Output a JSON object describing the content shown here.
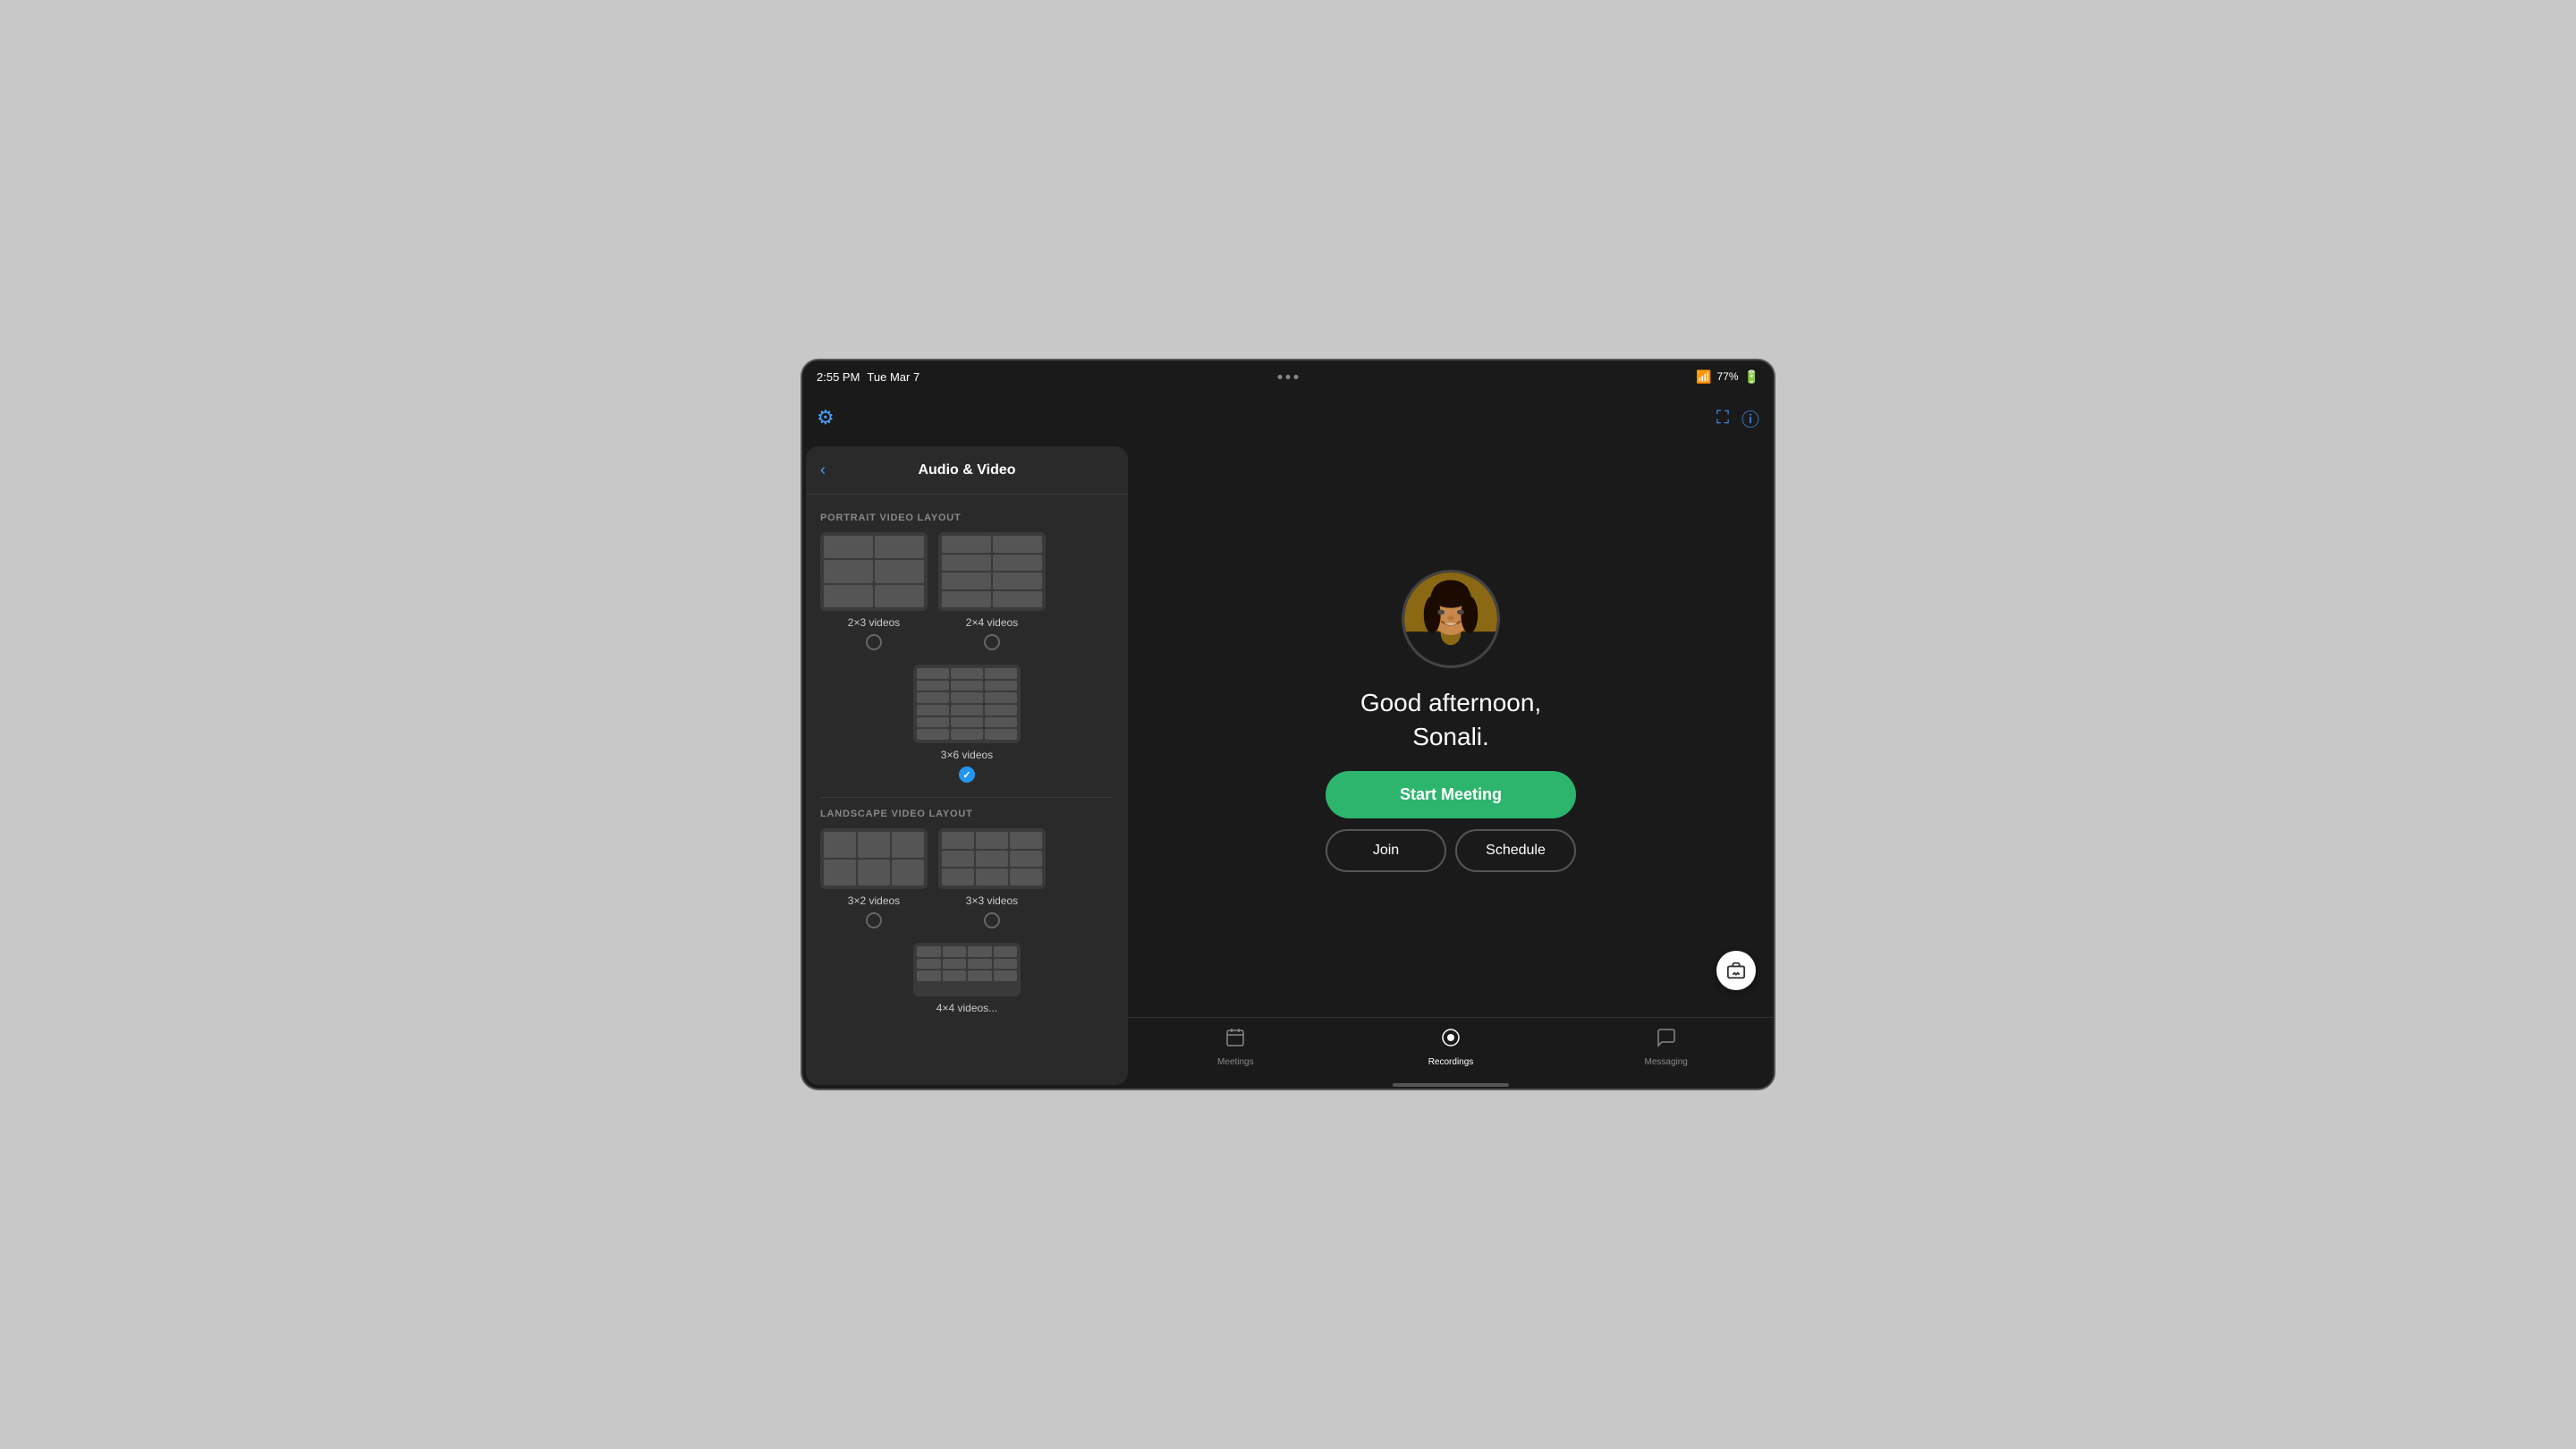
{
  "device": {
    "status_bar": {
      "time": "2:55 PM",
      "date": "Tue Mar 7",
      "wifi_percent": "77%",
      "dots": [
        "●",
        "●",
        "●"
      ]
    }
  },
  "settings_panel": {
    "title": "Audio & Video",
    "back_label": "‹",
    "portrait_section_label": "PORTRAIT VIDEO LAYOUT",
    "landscape_section_label": "LANDSCAPE VIDEO LAYOUT",
    "portrait_layouts": [
      {
        "id": "2x3",
        "label": "2×3 videos",
        "cols": 2,
        "rows": 3,
        "selected": false
      },
      {
        "id": "2x4",
        "label": "2×4 videos",
        "cols": 2,
        "rows": 4,
        "selected": false
      },
      {
        "id": "3x6",
        "label": "3×6 videos",
        "cols": 3,
        "rows": 6,
        "selected": true
      }
    ],
    "landscape_layouts": [
      {
        "id": "3x2",
        "label": "3×2 videos",
        "cols": 3,
        "rows": 2,
        "selected": false
      },
      {
        "id": "3x3",
        "label": "3×3 videos",
        "cols": 3,
        "rows": 3,
        "selected": false
      },
      {
        "id": "4x4",
        "label": "4×4 videos...",
        "cols": 4,
        "rows": 4,
        "selected": false
      }
    ]
  },
  "home": {
    "greeting": "Good afternoon,\nSonali.",
    "start_meeting_label": "Start Meeting",
    "join_label": "Join",
    "schedule_label": "Schedule"
  },
  "bottom_nav": {
    "items": [
      {
        "id": "meetings",
        "label": "Meetings",
        "icon": "📅",
        "active": false
      },
      {
        "id": "recordings",
        "label": "Recordings",
        "icon": "⏺",
        "active": true
      },
      {
        "id": "messaging",
        "label": "Messaging",
        "icon": "💬",
        "active": false
      }
    ]
  }
}
